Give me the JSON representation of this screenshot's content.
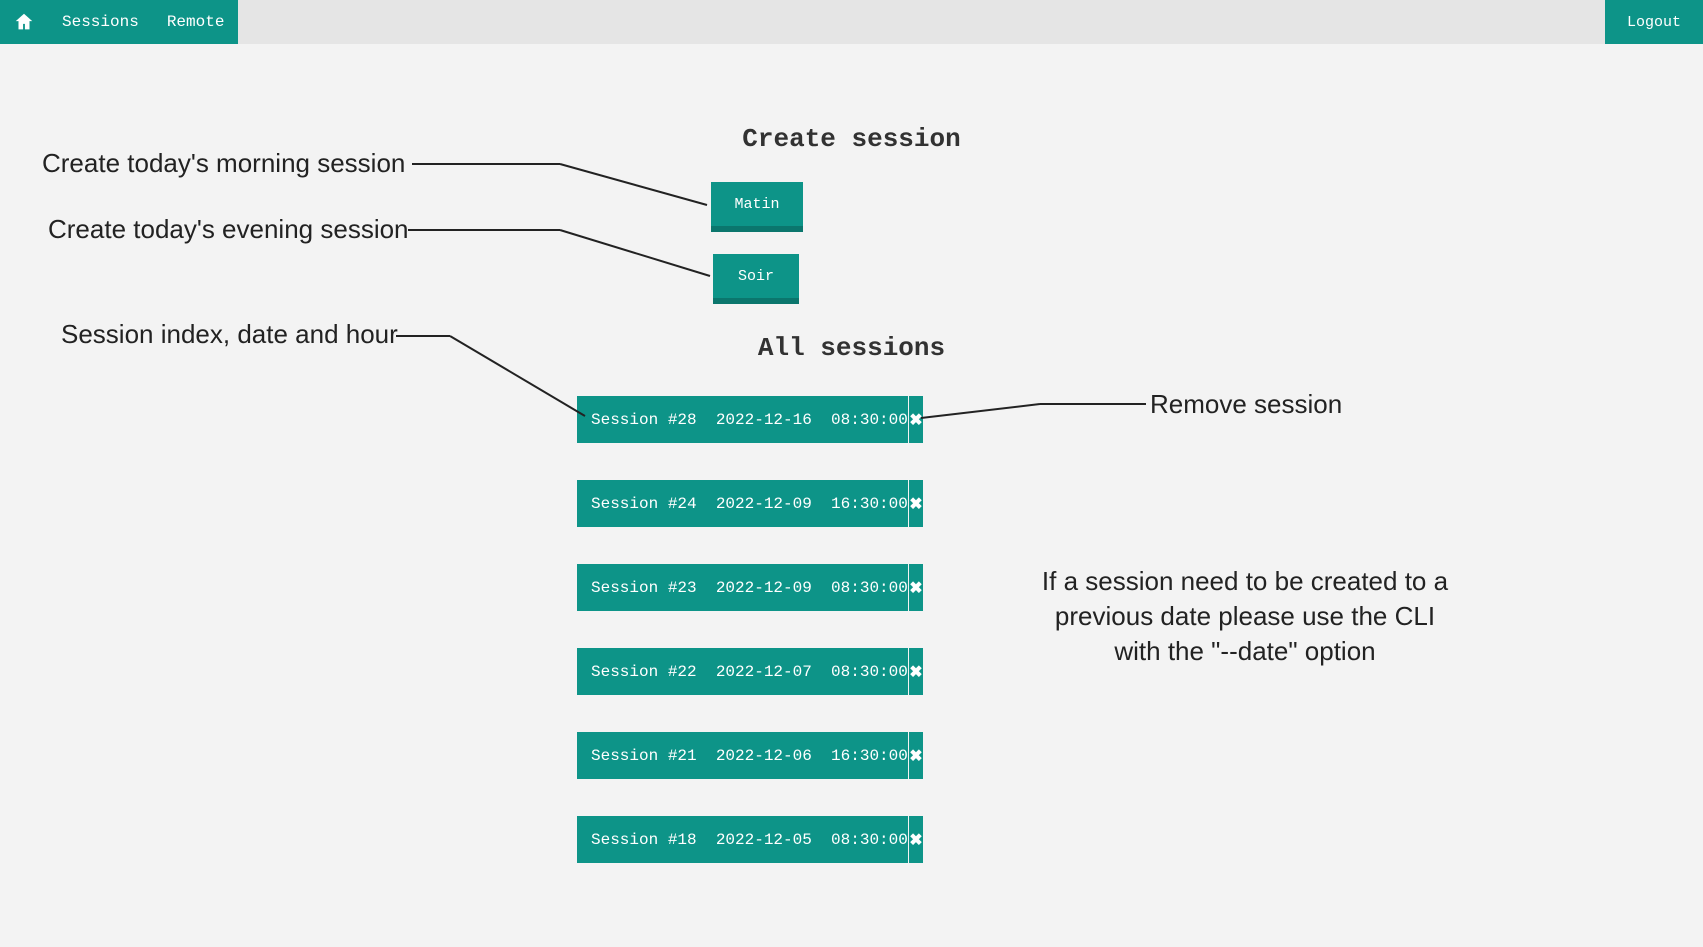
{
  "nav": {
    "sessions": "Sessions",
    "remote": "Remote",
    "logout": "Logout"
  },
  "headings": {
    "create": "Create session",
    "all": "All sessions"
  },
  "buttons": {
    "matin": "Matin",
    "soir": "Soir"
  },
  "annotations": {
    "morning": "Create today's morning session",
    "evening": "Create today's evening session",
    "rowinfo": "Session index, date and hour",
    "remove": "Remove session",
    "cli": "If a session need to be created to a previous date please use the CLI with the \"--date\" option"
  },
  "sessions": [
    {
      "label": "Session #28  2022-12-16  08:30:00"
    },
    {
      "label": "Session #24  2022-12-09  16:30:00"
    },
    {
      "label": "Session #23  2022-12-09  08:30:00"
    },
    {
      "label": "Session #22  2022-12-07  08:30:00"
    },
    {
      "label": "Session #21  2022-12-06  16:30:00"
    },
    {
      "label": "Session #18  2022-12-05  08:30:00"
    }
  ],
  "close_glyph": "✖"
}
